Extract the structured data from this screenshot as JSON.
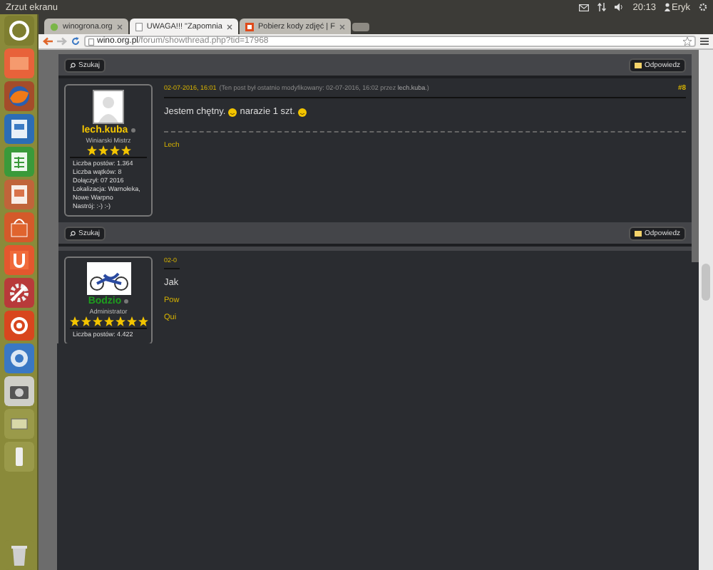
{
  "panel": {
    "title": "Zrzut ekranu",
    "clock": "20:13",
    "user": "Eryk"
  },
  "launcher": [
    {
      "kind": "home"
    },
    {
      "kind": "folder"
    },
    {
      "kind": "globe"
    },
    {
      "kind": "document"
    },
    {
      "kind": "sheet"
    },
    {
      "kind": "slides"
    },
    {
      "kind": "bag"
    },
    {
      "kind": "letter"
    },
    {
      "kind": "gear"
    },
    {
      "kind": "logo"
    },
    {
      "kind": "ring"
    },
    {
      "kind": "camera"
    },
    {
      "kind": "drive"
    },
    {
      "kind": "usb"
    },
    {
      "kind": "trash"
    }
  ],
  "tabs": [
    {
      "title": "winogrona.org",
      "selected": false,
      "icon": {
        "kind": "grape"
      }
    },
    {
      "title": "UWAGA!!! \"Zapomnia",
      "selected": true,
      "icon": {
        "kind": "page"
      }
    },
    {
      "title": "Pobierz kody zdjęć | F",
      "selected": false,
      "icon": {
        "kind": "image"
      }
    }
  ],
  "address": {
    "host": "wino.org.pl",
    "path": "/forum/showthread.php?tid=17968"
  },
  "posts": [
    {
      "footer": {
        "search": "Szukaj",
        "reply": "Odpowiedz"
      }
    },
    {
      "date": "02-07-2016, 16:01",
      "edited": "(Ten post był ostatnio modyfikowany: 02-07-2016, 16:02 przez ",
      "editor": "lech.kuba",
      "edited_end": ".)",
      "number": "#8",
      "user": {
        "name": "lech.kuba",
        "kind": "member",
        "online": false,
        "avatar": {
          "kind": "silhouette"
        },
        "rank": "Winiarski Mistrz",
        "stars": 4,
        "stats": [
          "Liczba postów: 1.364",
          "Liczba wątków: 8",
          "Dołączył: 07 2016",
          "Lokalizacja: Warnołeka, Nowe Warpno",
          "Nastrój: :-) :-)"
        ]
      },
      "message": [
        {
          "kind": "text",
          "text": "Jestem chętny."
        },
        {
          "kind": "smiley"
        },
        {
          "kind": "text",
          "text": "narazie 1 szt."
        },
        {
          "kind": "smiley"
        }
      ],
      "signature": "Lech",
      "footer": {
        "search": "Szukaj",
        "reply": "Odpowiedz"
      }
    },
    {
      "date": "02-0",
      "user": {
        "name": "Bodzio",
        "kind": "admin",
        "online": false,
        "avatar": {
          "kind": "bike"
        },
        "rank": "Administrator",
        "stars": 7,
        "stats": [
          "Liczba postów: 4.422"
        ]
      },
      "message": [
        {
          "kind": "text",
          "text": "Jak"
        }
      ],
      "lines": [
        "Pow",
        "Qui"
      ]
    }
  ]
}
